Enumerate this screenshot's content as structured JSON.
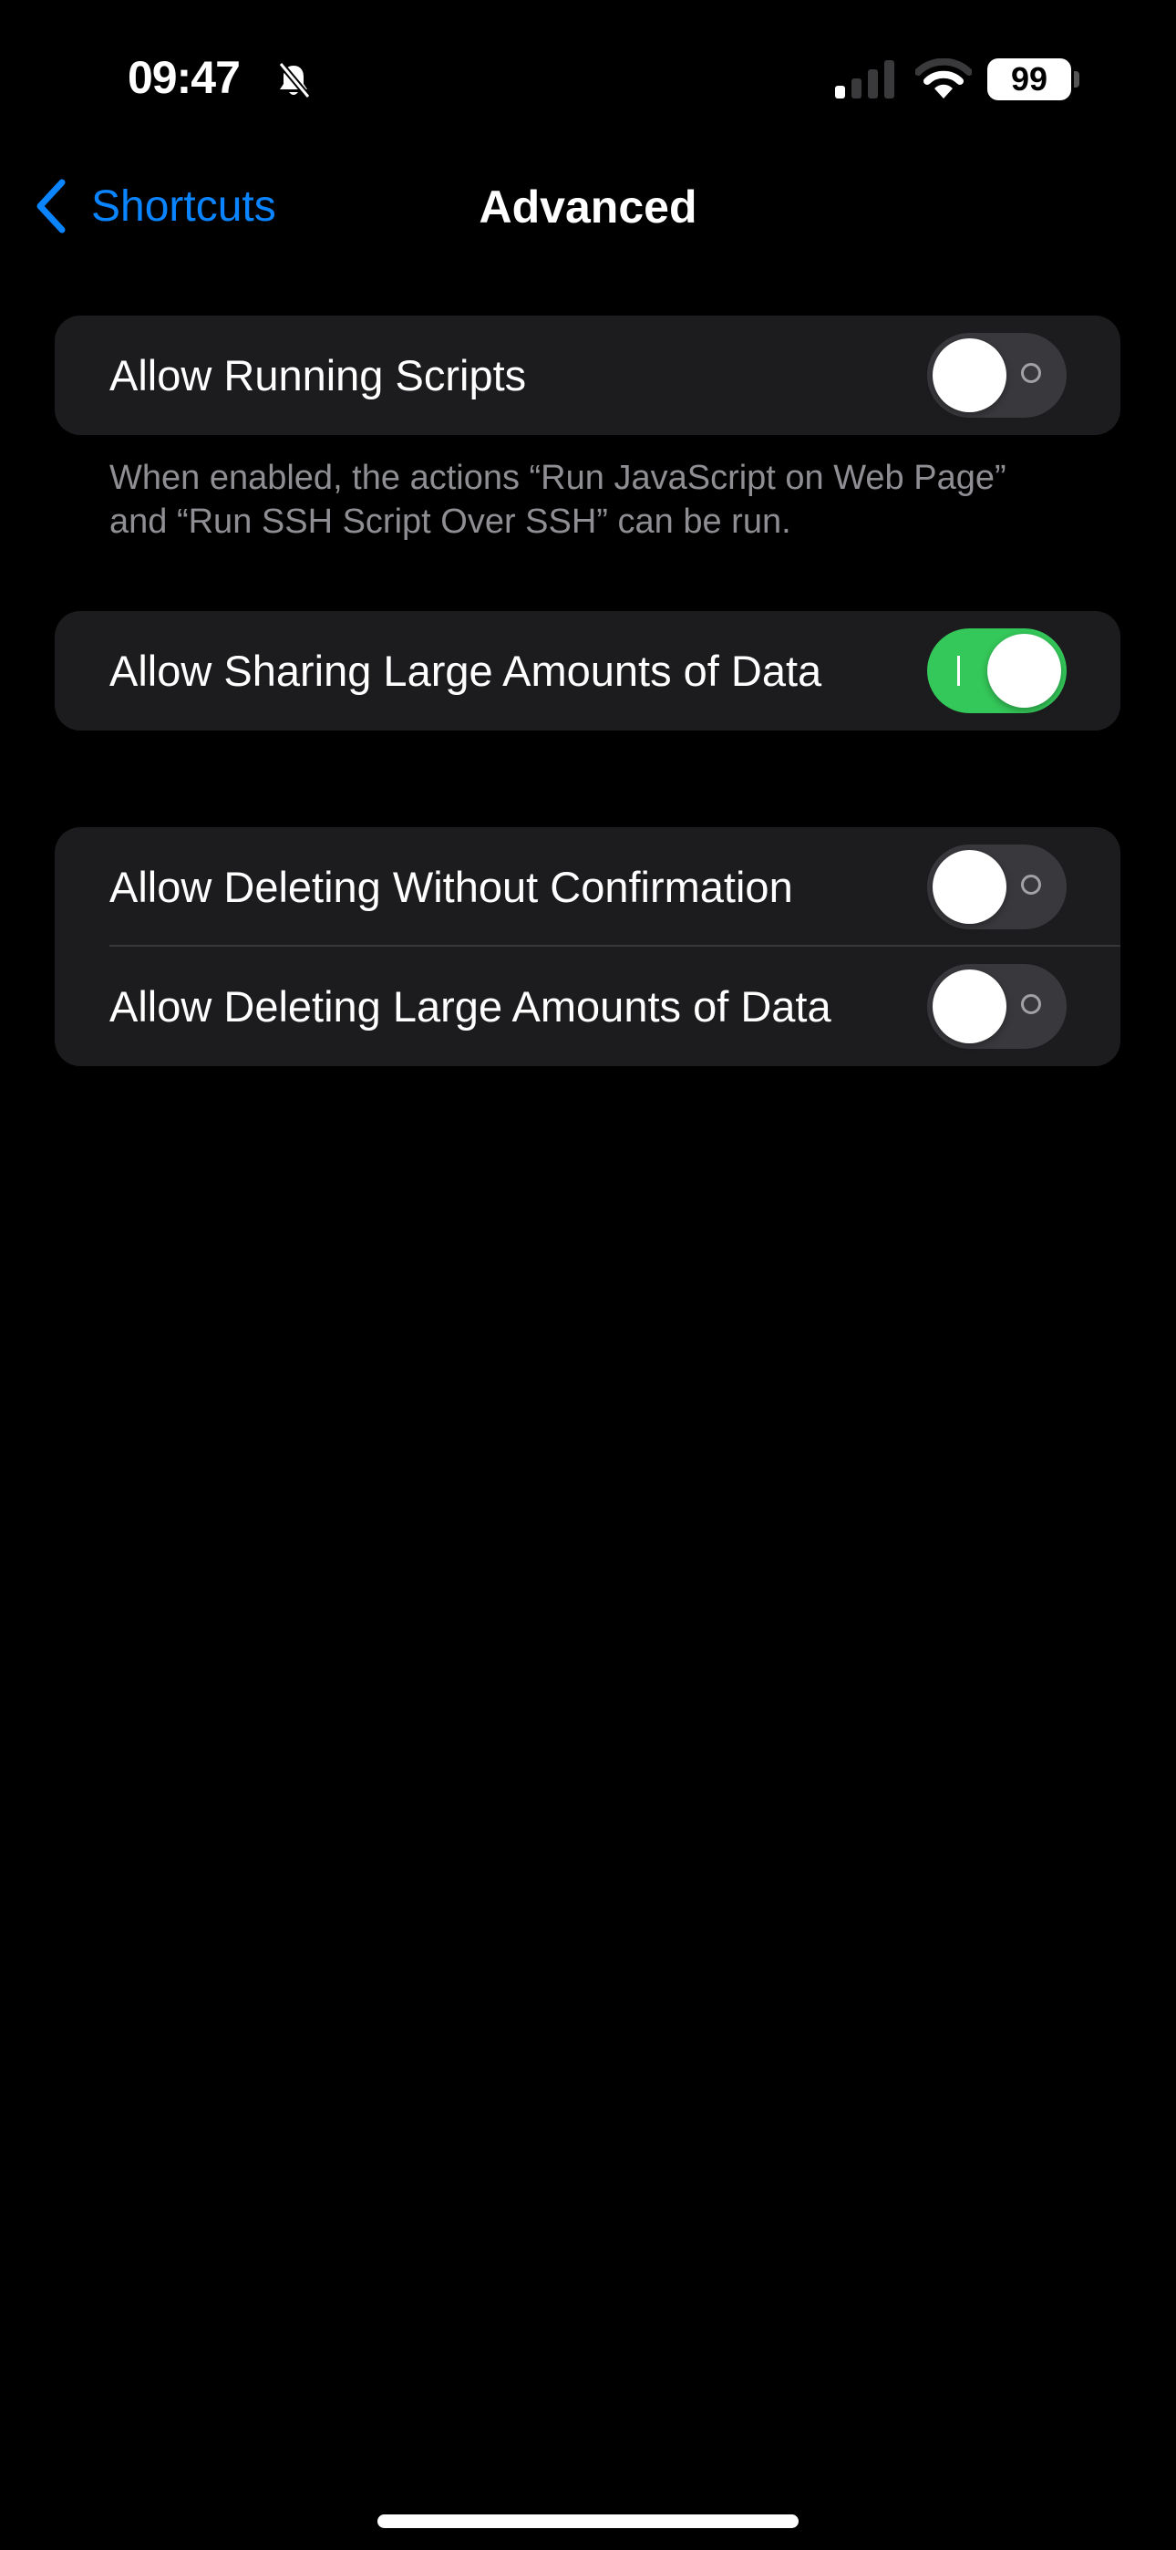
{
  "status_bar": {
    "time": "09:47",
    "silent_icon": "bell-slash-icon",
    "signal_bars_active": 1,
    "signal_bars_total": 4,
    "wifi_arcs_active": 2,
    "wifi_arcs_total": 3,
    "battery_level": "99"
  },
  "nav": {
    "back_label": "Shortcuts",
    "title": "Advanced"
  },
  "sections": [
    {
      "rows": [
        {
          "label": "Allow Running Scripts",
          "enabled": false
        }
      ],
      "footer": "When enabled, the actions “Run JavaScript on Web Page” and “Run SSH Script Over SSH” can be run."
    },
    {
      "rows": [
        {
          "label": "Allow Sharing Large Amounts of Data",
          "enabled": true
        }
      ]
    },
    {
      "rows": [
        {
          "label": "Allow Deleting Without Confirmation",
          "enabled": false
        },
        {
          "label": "Allow Deleting Large Amounts of Data",
          "enabled": false
        }
      ]
    }
  ],
  "colors": {
    "accent": "#0a84ff",
    "toggle_on": "#34c759",
    "toggle_off": "#39393d",
    "card_bg": "#1c1c1e",
    "footer_text": "#8e8e93"
  }
}
